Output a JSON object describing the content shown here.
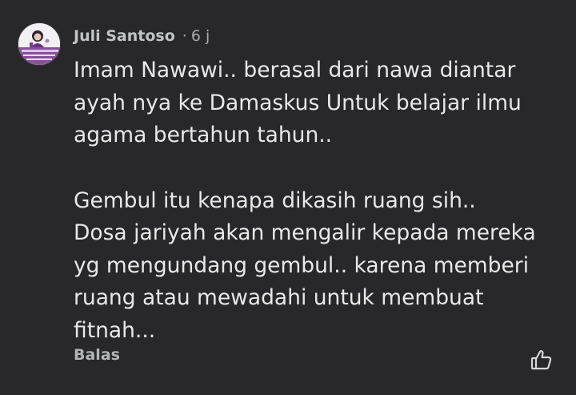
{
  "comment": {
    "author": "Juli Santoso",
    "separator": "·",
    "time": "6 j",
    "lines": [
      "Imam Nawawi.. berasal dari nawa diantar",
      "ayah nya ke Damaskus Untuk belajar ilmu",
      "agama bertahun tahun..",
      "Gembul itu kenapa dikasih ruang sih..",
      "Dosa jariyah akan mengalir kepada mereka",
      "yg mengundang gembul.. karena memberi",
      "ruang atau mewadahi untuk membuat",
      "fitnah..."
    ],
    "reply_label": "Balas",
    "like_icon": "thumbs-up-icon",
    "avatar_icon": "profile-photo"
  },
  "colors": {
    "background": "#28282a",
    "text": "#e8e8e8",
    "secondary_text": "#a8a9ac"
  }
}
